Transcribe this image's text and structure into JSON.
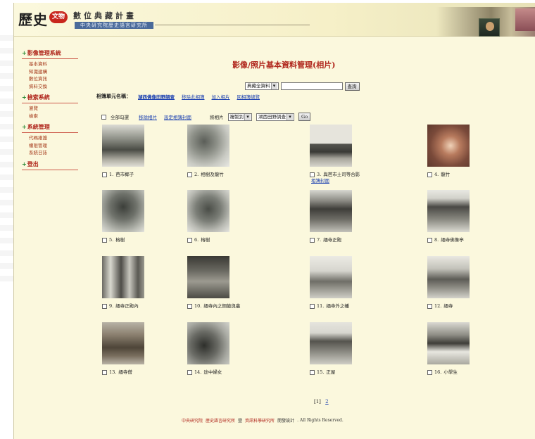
{
  "header": {
    "logo_text": "歷史",
    "logo_badge": "文物",
    "project_title": "數位典藏計畫",
    "project_subtitle": "中央研究院歷史語言研究所"
  },
  "sidebar": [
    {
      "title": "影像管理系統",
      "items": [
        "基本資料",
        "知識建構",
        "數位資訊",
        "資料交換"
      ]
    },
    {
      "title": "檢索系統",
      "items": [
        "瀏覽",
        "檢索"
      ]
    },
    {
      "title": "系統管理",
      "items": [
        "代碼維護",
        "權限管理",
        "系統日誌"
      ]
    },
    {
      "title": "登出",
      "items": []
    }
  ],
  "page_title": "影像/照片基本資料管理(相片)",
  "search": {
    "scope_select": "典藏全資料",
    "query_value": "",
    "search_button": "查詢"
  },
  "folder": {
    "label": "相簿單元名稱：",
    "name": "湖西佛像田野調查",
    "links": [
      "移除此相簿",
      "加入相片",
      "回相簿總覽"
    ]
  },
  "actions": {
    "select_all_label": "全部勾選",
    "remove_link": "移除相片",
    "set_cover_link": "設定相簿封面",
    "move_label": "將相片",
    "move_select": "複製到",
    "target_select": "湖西田野調查",
    "go_button": "Go"
  },
  "photos": [
    {
      "num": "1.",
      "title": "芭市椰子"
    },
    {
      "num": "2.",
      "title": "相樹及龍竹"
    },
    {
      "num": "3.",
      "title": "與芭市土司等合影",
      "extra": "相簿封面"
    },
    {
      "num": "4.",
      "title": "龍竹"
    },
    {
      "num": "5.",
      "title": "榕樹"
    },
    {
      "num": "6.",
      "title": "榕樹"
    },
    {
      "num": "7.",
      "title": "緬寺正殿"
    },
    {
      "num": "8.",
      "title": "緬寺佛像亭"
    },
    {
      "num": "9.",
      "title": "緬寺正殿內"
    },
    {
      "num": "10.",
      "title": "緬寺內之銅鼓與龕"
    },
    {
      "num": "11.",
      "title": "緬寺外之幡"
    },
    {
      "num": "12.",
      "title": "緬寺"
    },
    {
      "num": "13.",
      "title": "緬寺僧"
    },
    {
      "num": "14.",
      "title": "途中婦女"
    },
    {
      "num": "15.",
      "title": "正屋"
    },
    {
      "num": "16.",
      "title": "小學生"
    }
  ],
  "pager": {
    "current": "[1]",
    "next": "2"
  },
  "footer": {
    "org1": "中央研究院",
    "org2": "歷史語言研究所",
    "sep": "暨",
    "org3": "資訊科學研究所",
    "design": "開發設計",
    "rights": ". All Rights Reserved."
  }
}
